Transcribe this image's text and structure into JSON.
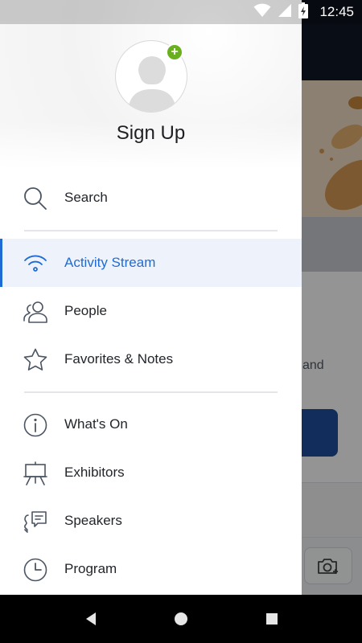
{
  "status_bar": {
    "time": "12:45",
    "icons": [
      "wifi-icon",
      "cell-signal-icon",
      "battery-charging-icon"
    ]
  },
  "drawer": {
    "title": "Sign Up",
    "avatar_badge": "+",
    "groups": [
      {
        "items": [
          {
            "label": "Search",
            "icon": "search-icon"
          }
        ]
      },
      {
        "items": [
          {
            "label": "Activity Stream",
            "icon": "wifi-stream-icon",
            "active": true
          },
          {
            "label": "People",
            "icon": "people-icon"
          },
          {
            "label": "Favorites & Notes",
            "icon": "star-icon"
          }
        ]
      },
      {
        "items": [
          {
            "label": "What's On",
            "icon": "info-icon"
          },
          {
            "label": "Exhibitors",
            "icon": "easel-icon"
          },
          {
            "label": "Speakers",
            "icon": "speaker-chat-icon"
          },
          {
            "label": "Program",
            "icon": "clock-icon"
          }
        ]
      }
    ]
  },
  "background_app": {
    "partial_text": "and"
  },
  "nav_bar": {
    "buttons": [
      "back-icon",
      "home-icon",
      "recents-icon"
    ]
  },
  "colors": {
    "accent": "#1e6bd6",
    "badge_green": "#6ab01e",
    "active_bg": "#eef3fb",
    "icon_gray": "#4b5563"
  }
}
